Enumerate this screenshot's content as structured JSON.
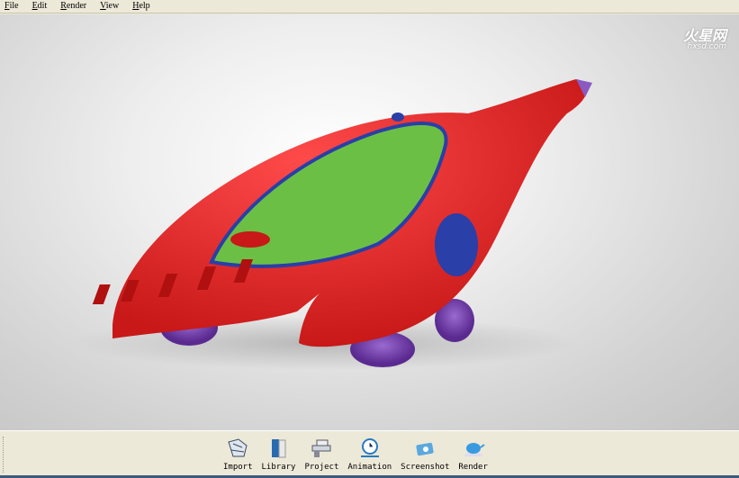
{
  "menu": [
    "File",
    "Edit",
    "Render",
    "View",
    "Help"
  ],
  "watermark": {
    "cn": "火星网",
    "en": "hxsd.com"
  },
  "toolbar": [
    {
      "label": "Import",
      "icon": "import-icon"
    },
    {
      "label": "Library",
      "icon": "library-icon"
    },
    {
      "label": "Project",
      "icon": "project-icon"
    },
    {
      "label": "Animation",
      "icon": "animation-icon"
    },
    {
      "label": "Screenshot",
      "icon": "screenshot-icon"
    },
    {
      "label": "Render",
      "icon": "render-icon"
    }
  ],
  "colors": {
    "body": "#e82a2a",
    "canopy": "#6cbf45",
    "trim": "#2a3fa8",
    "wheels": "#7a4ab0"
  }
}
